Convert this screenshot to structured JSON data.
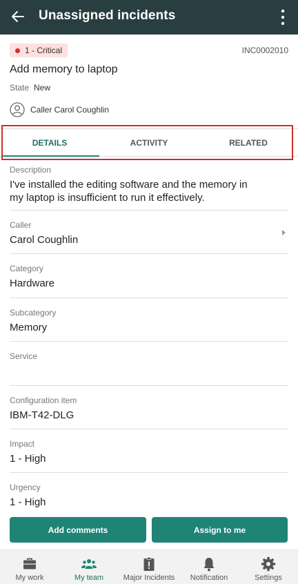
{
  "appbar": {
    "title": "Unassigned incidents"
  },
  "incident": {
    "priority": "1 - Critical",
    "number": "INC0002010",
    "short_description": "Add memory to laptop",
    "state_label": "State",
    "state_value": "New",
    "caller_line": "Caller Carol Coughlin"
  },
  "tabs": [
    {
      "label": "DETAILS",
      "active": true
    },
    {
      "label": "ACTIVITY",
      "active": false
    },
    {
      "label": "RELATED",
      "active": false
    }
  ],
  "fields": {
    "description": {
      "label": "Description",
      "value": "I've installed the editing software and the memory in my laptop is insufficient to run it effectively."
    },
    "caller": {
      "label": "Caller",
      "value": "Carol Coughlin"
    },
    "category": {
      "label": "Category",
      "value": "Hardware"
    },
    "subcategory": {
      "label": "Subcategory",
      "value": "Memory"
    },
    "service": {
      "label": "Service",
      "value": ""
    },
    "configuration_item": {
      "label": "Configuration item",
      "value": "IBM-T42-DLG"
    },
    "impact": {
      "label": "Impact",
      "value": "1 - High"
    },
    "urgency": {
      "label": "Urgency",
      "value": "1 - High"
    }
  },
  "actions": {
    "add_comments": "Add comments",
    "assign_to_me": "Assign to me"
  },
  "bottom_nav": [
    {
      "label": "My work",
      "icon": "briefcase-icon",
      "active": false
    },
    {
      "label": "My team",
      "icon": "team-icon",
      "active": true
    },
    {
      "label": "Major Incidents",
      "icon": "clipboard-alert-icon",
      "active": false
    },
    {
      "label": "Notification",
      "icon": "bell-icon",
      "active": false
    },
    {
      "label": "Settings",
      "icon": "gear-icon",
      "active": false
    }
  ],
  "colors": {
    "appbar": "#293e40",
    "accent": "#1f8476",
    "critical": "#d62c2c",
    "critical_bg": "#fde0df",
    "highlight_box": "#c9302c"
  }
}
